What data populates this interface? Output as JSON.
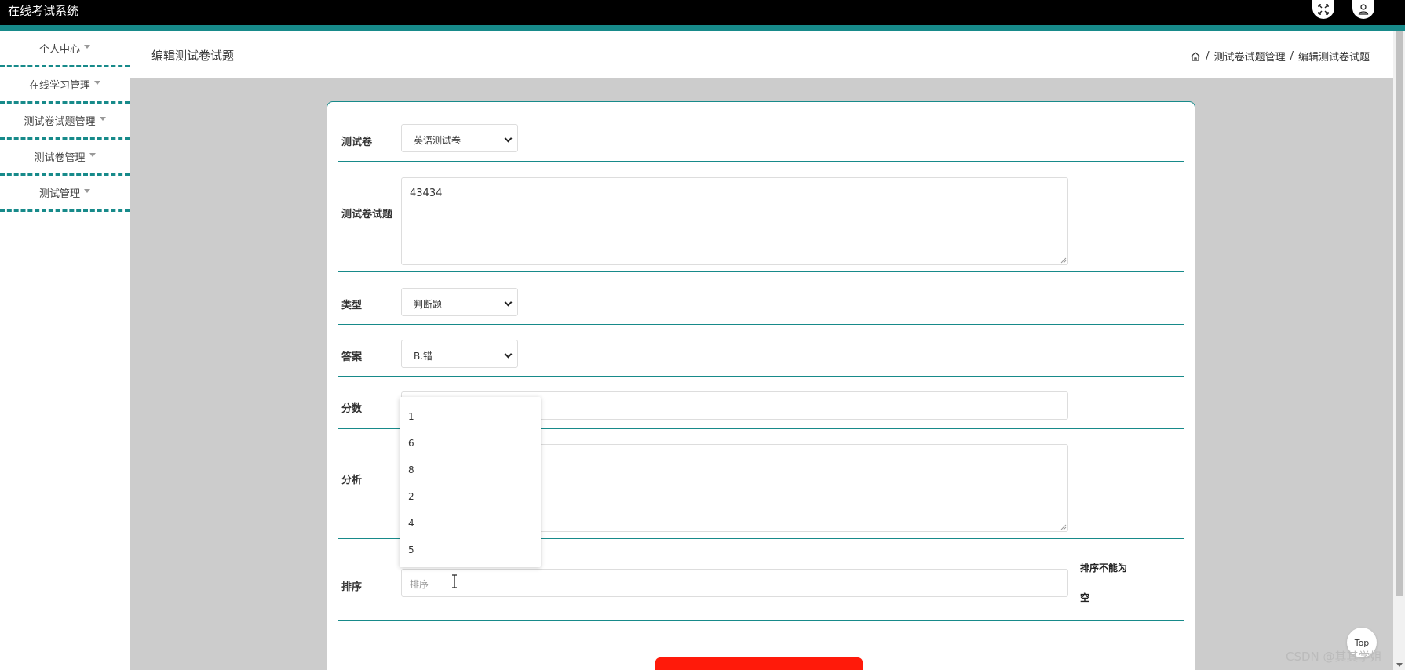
{
  "app": {
    "title": "在线考试系统"
  },
  "sidebar": {
    "items": [
      {
        "label": "个人中心"
      },
      {
        "label": "在线学习管理"
      },
      {
        "label": "测试卷试题管理"
      },
      {
        "label": "测试卷管理"
      },
      {
        "label": "测试管理"
      }
    ]
  },
  "header": {
    "page_title": "编辑测试卷试题",
    "breadcrumb": [
      "测试卷试题管理",
      "编辑测试卷试题"
    ],
    "separator": "/"
  },
  "form": {
    "paper": {
      "label": "测试卷",
      "value": "英语测试卷"
    },
    "question": {
      "label": "测试卷试题",
      "value": "43434"
    },
    "type": {
      "label": "类型",
      "value": "判断题"
    },
    "answer": {
      "label": "答案",
      "value": "B.错"
    },
    "score": {
      "label": "分数",
      "value": ""
    },
    "analysis": {
      "label": "分析",
      "value": ""
    },
    "sort": {
      "label": "排序",
      "placeholder": "排序",
      "error": "排序不能为空"
    }
  },
  "autocomplete_options": [
    "1",
    "6",
    "8",
    "2",
    "4",
    "5"
  ],
  "top_button": "Top",
  "watermark": "CSDN @其其学姐",
  "colors": {
    "accent": "#178a8a",
    "submit": "#ff1a0a",
    "background": "#cccccc"
  }
}
